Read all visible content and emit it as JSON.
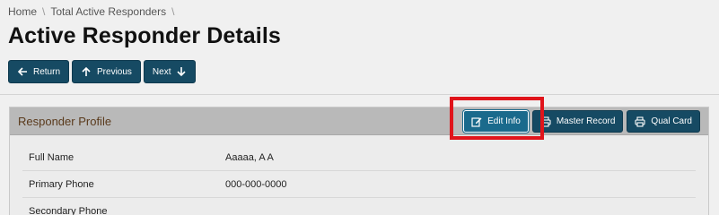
{
  "breadcrumb": {
    "home": "Home",
    "sep": "\\",
    "current": "Total Active Responders"
  },
  "page": {
    "title": "Active Responder Details"
  },
  "nav": {
    "return_label": "Return",
    "previous_label": "Previous",
    "next_label": "Next"
  },
  "panel": {
    "title": "Responder Profile",
    "actions": {
      "edit_label": "Edit Info",
      "master_label": "Master Record",
      "qual_label": "Qual Card"
    }
  },
  "profile": {
    "rows": [
      {
        "label": "Full Name",
        "value": "Aaaaa, A A"
      },
      {
        "label": "Primary Phone",
        "value": "000-000-0000"
      },
      {
        "label": "Secondary Phone",
        "value": ""
      }
    ]
  },
  "colors": {
    "button": "#164a63",
    "highlight": "#e0141b",
    "panel_header": "#b9b9b9",
    "panel_title": "#5a3a1c"
  }
}
